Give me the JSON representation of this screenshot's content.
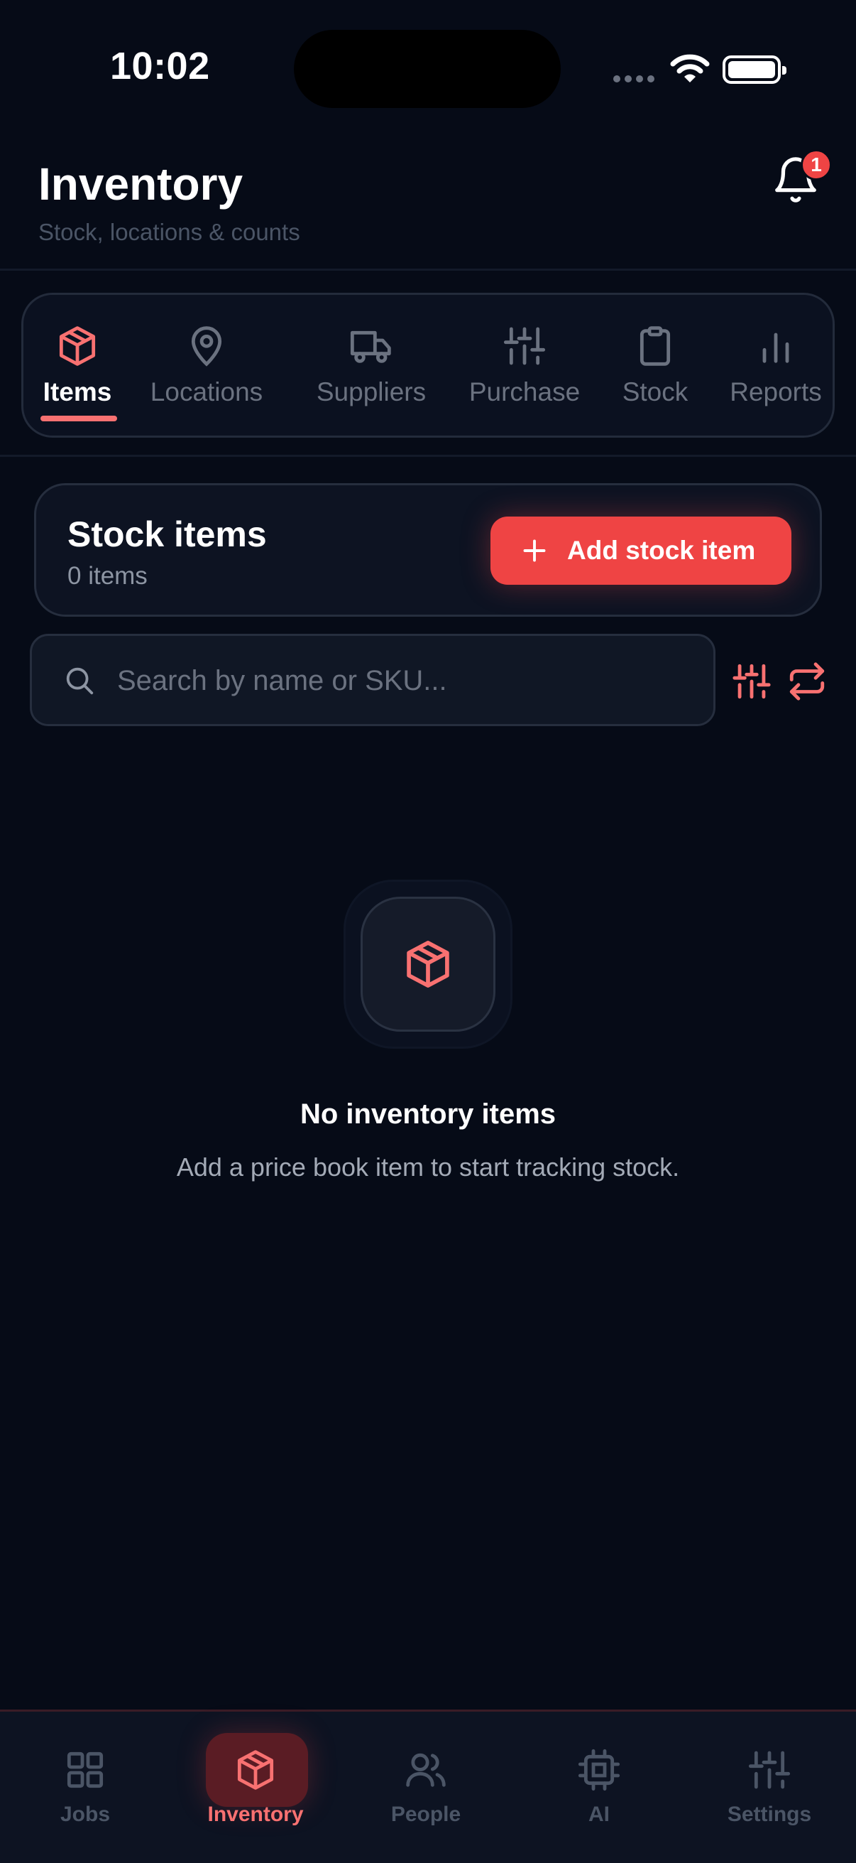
{
  "status_bar": {
    "time": "10:02"
  },
  "header": {
    "title": "Inventory",
    "subtitle": "Stock, locations & counts",
    "notification_count": "1"
  },
  "tabs": [
    {
      "label": "Items",
      "icon": "box-icon",
      "active": true
    },
    {
      "label": "Locations",
      "icon": "map-pin-icon",
      "active": false
    },
    {
      "label": "Suppliers",
      "icon": "truck-icon",
      "active": false
    },
    {
      "label": "Purchase",
      "icon": "sliders-icon",
      "active": false
    },
    {
      "label": "Stock",
      "icon": "clipboard-icon",
      "active": false
    },
    {
      "label": "Reports",
      "icon": "bar-chart-icon",
      "active": false
    }
  ],
  "stock_card": {
    "title": "Stock items",
    "count": "0 items",
    "add_button_label": "Add stock item"
  },
  "search": {
    "placeholder": "Search by name or SKU..."
  },
  "empty_state": {
    "title": "No inventory items",
    "subtitle": "Add a price book item to start tracking stock."
  },
  "bottom_nav": [
    {
      "label": "Jobs",
      "icon": "grid-icon",
      "active": false
    },
    {
      "label": "Inventory",
      "icon": "box-icon",
      "active": true
    },
    {
      "label": "People",
      "icon": "users-icon",
      "active": false
    },
    {
      "label": "AI",
      "icon": "chip-icon",
      "active": false
    },
    {
      "label": "Settings",
      "icon": "sliders-icon",
      "active": false
    }
  ],
  "colors": {
    "background": "#060b17",
    "accent": "#ef4444",
    "accent_soft": "#f87171",
    "muted": "#6b7280"
  }
}
